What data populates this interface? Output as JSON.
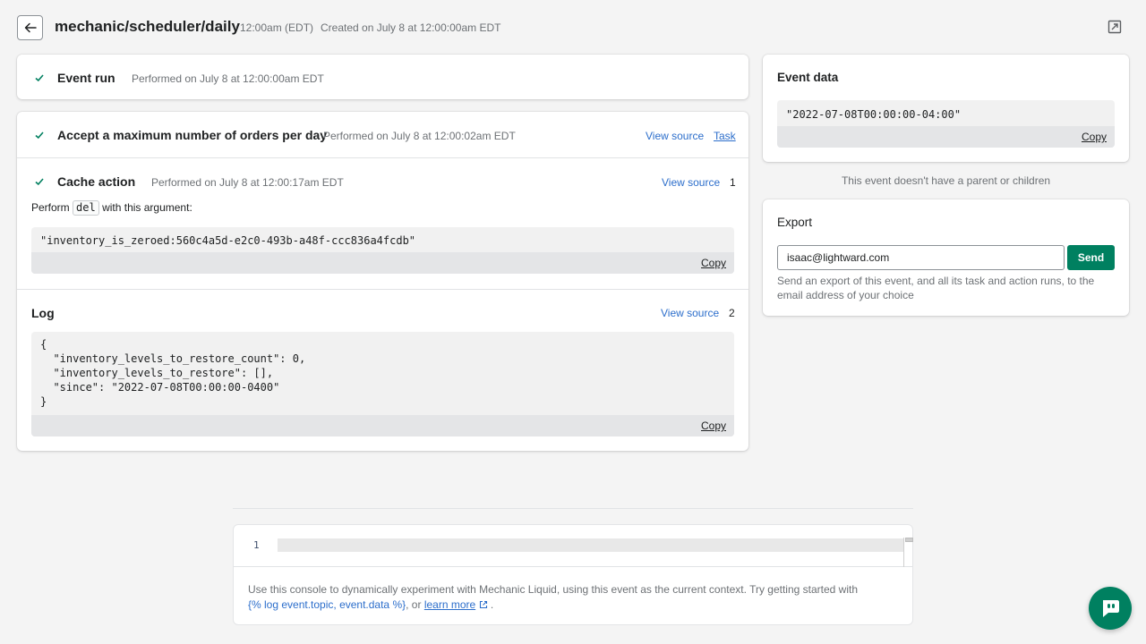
{
  "header": {
    "title": "mechanic/scheduler/daily",
    "time": "12:00am (EDT)",
    "created": "Created on July 8 at 12:00:00am EDT"
  },
  "event_run": {
    "title": "Event run",
    "meta": "Performed on July 8 at 12:00:00am EDT"
  },
  "task_card": {
    "task": {
      "title": "Accept a maximum number of orders per day",
      "meta": "Performed on July 8 at 12:00:02am EDT",
      "view_source": "View source",
      "task_link": "Task"
    },
    "action": {
      "title": "Cache action",
      "meta": "Performed on July 8 at 12:00:17am EDT",
      "view_source": "View source",
      "count": "1",
      "perform_prefix": "Perform",
      "perform_code": "del",
      "perform_suffix": "with this argument:",
      "argument": "\"inventory_is_zeroed:560c4a5d-e2c0-493b-a48f-ccc836a4fcdb\"",
      "copy": "Copy"
    },
    "log": {
      "title": "Log",
      "view_source": "View source",
      "count": "2",
      "content": "{\n  \"inventory_levels_to_restore_count\": 0,\n  \"inventory_levels_to_restore\": [],\n  \"since\": \"2022-07-08T00:00:00-0400\"\n}",
      "copy": "Copy"
    }
  },
  "event_data": {
    "title": "Event data",
    "value": "\"2022-07-08T00:00:00-04:00\"",
    "copy": "Copy"
  },
  "relations_note": "This event doesn't have a parent or children",
  "export": {
    "title": "Export",
    "email_value": "isaac@lightward.com",
    "send_label": "Send",
    "help": "Send an export of this event, and all its task and action runs, to the email address of your choice"
  },
  "console": {
    "line_number": "1",
    "help_text": "Use this console to dynamically experiment with Mechanic Liquid, using this event as the current context. Try getting started with",
    "example_code": "{% log event.topic, event.data %}",
    "or_text": ", or",
    "learn_more": "learn more",
    "period": "."
  },
  "colors": {
    "accent": "#008060",
    "link": "#2c6ecb",
    "check": "#007f5f"
  },
  "icons": {
    "back": "arrow-left-icon",
    "expand": "external-expand-icon",
    "check": "checkmark-icon",
    "external": "external-link-icon",
    "chat": "chat-icon"
  }
}
